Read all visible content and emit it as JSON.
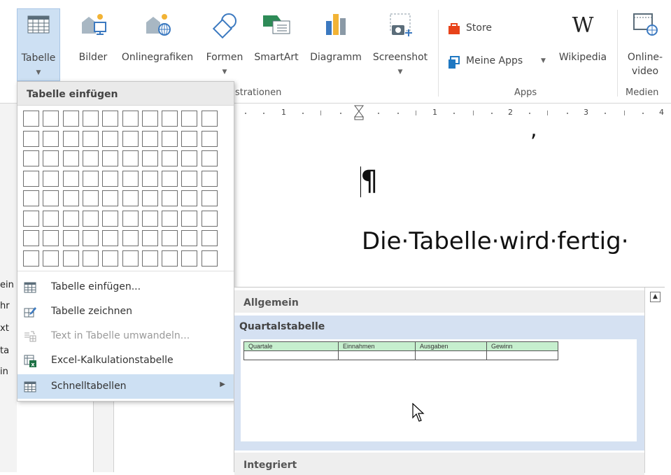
{
  "ribbon": {
    "tabelle": {
      "label": "Tabelle"
    },
    "bilder": {
      "label": "Bilder"
    },
    "onlinegrafiken": {
      "label": "Onlinegrafiken"
    },
    "formen": {
      "label": "Formen"
    },
    "smartart": {
      "label": "SmartArt"
    },
    "diagramm": {
      "label": "Diagramm"
    },
    "screenshot": {
      "label": "Screenshot"
    },
    "store": {
      "label": "Store"
    },
    "meine_apps": {
      "label": "Meine Apps"
    },
    "wikipedia": {
      "label": "Wikipedia"
    },
    "online_video": {
      "label_line1": "Online-",
      "label_line2": "video"
    },
    "groups": {
      "illustrationen": "strationen",
      "apps": "Apps",
      "medien": "Medien"
    }
  },
  "ruler": {
    "numbers": [
      "1",
      "1",
      "2",
      "3",
      "4"
    ]
  },
  "document": {
    "pilcrow": "¶",
    "line": "Die·Tabelle·wird·fertig·",
    "comma": ","
  },
  "left_edge": [
    "ein",
    "hr",
    "xt",
    "ta",
    "in"
  ],
  "menu": {
    "title": "Tabelle einfügen",
    "grid": {
      "cols": 10,
      "rows": 8
    },
    "items": [
      {
        "label": "Tabelle einfügen...",
        "icon": "table-icon"
      },
      {
        "label": "Tabelle zeichnen",
        "icon": "draw-table-icon"
      },
      {
        "label": "Text in Tabelle umwandeln...",
        "icon": "convert-text-icon",
        "disabled": true
      },
      {
        "label": "Excel-Kalkulationstabelle",
        "icon": "excel-icon"
      },
      {
        "label": "Schnelltabellen",
        "icon": "quick-table-icon",
        "active": true
      }
    ]
  },
  "submenu": {
    "header_general": "Allgemein",
    "selected_title": "Quartalstabelle",
    "preview_table": {
      "headers": [
        "Quartale",
        "Einnahmen",
        "Ausgaben",
        "Gewinn"
      ]
    },
    "header_builtin": "Integriert"
  },
  "colors": {
    "selection": "#cde0f3",
    "preview_header": "#c6efce",
    "store": "#e8431a",
    "apps": "#1f78c2"
  }
}
